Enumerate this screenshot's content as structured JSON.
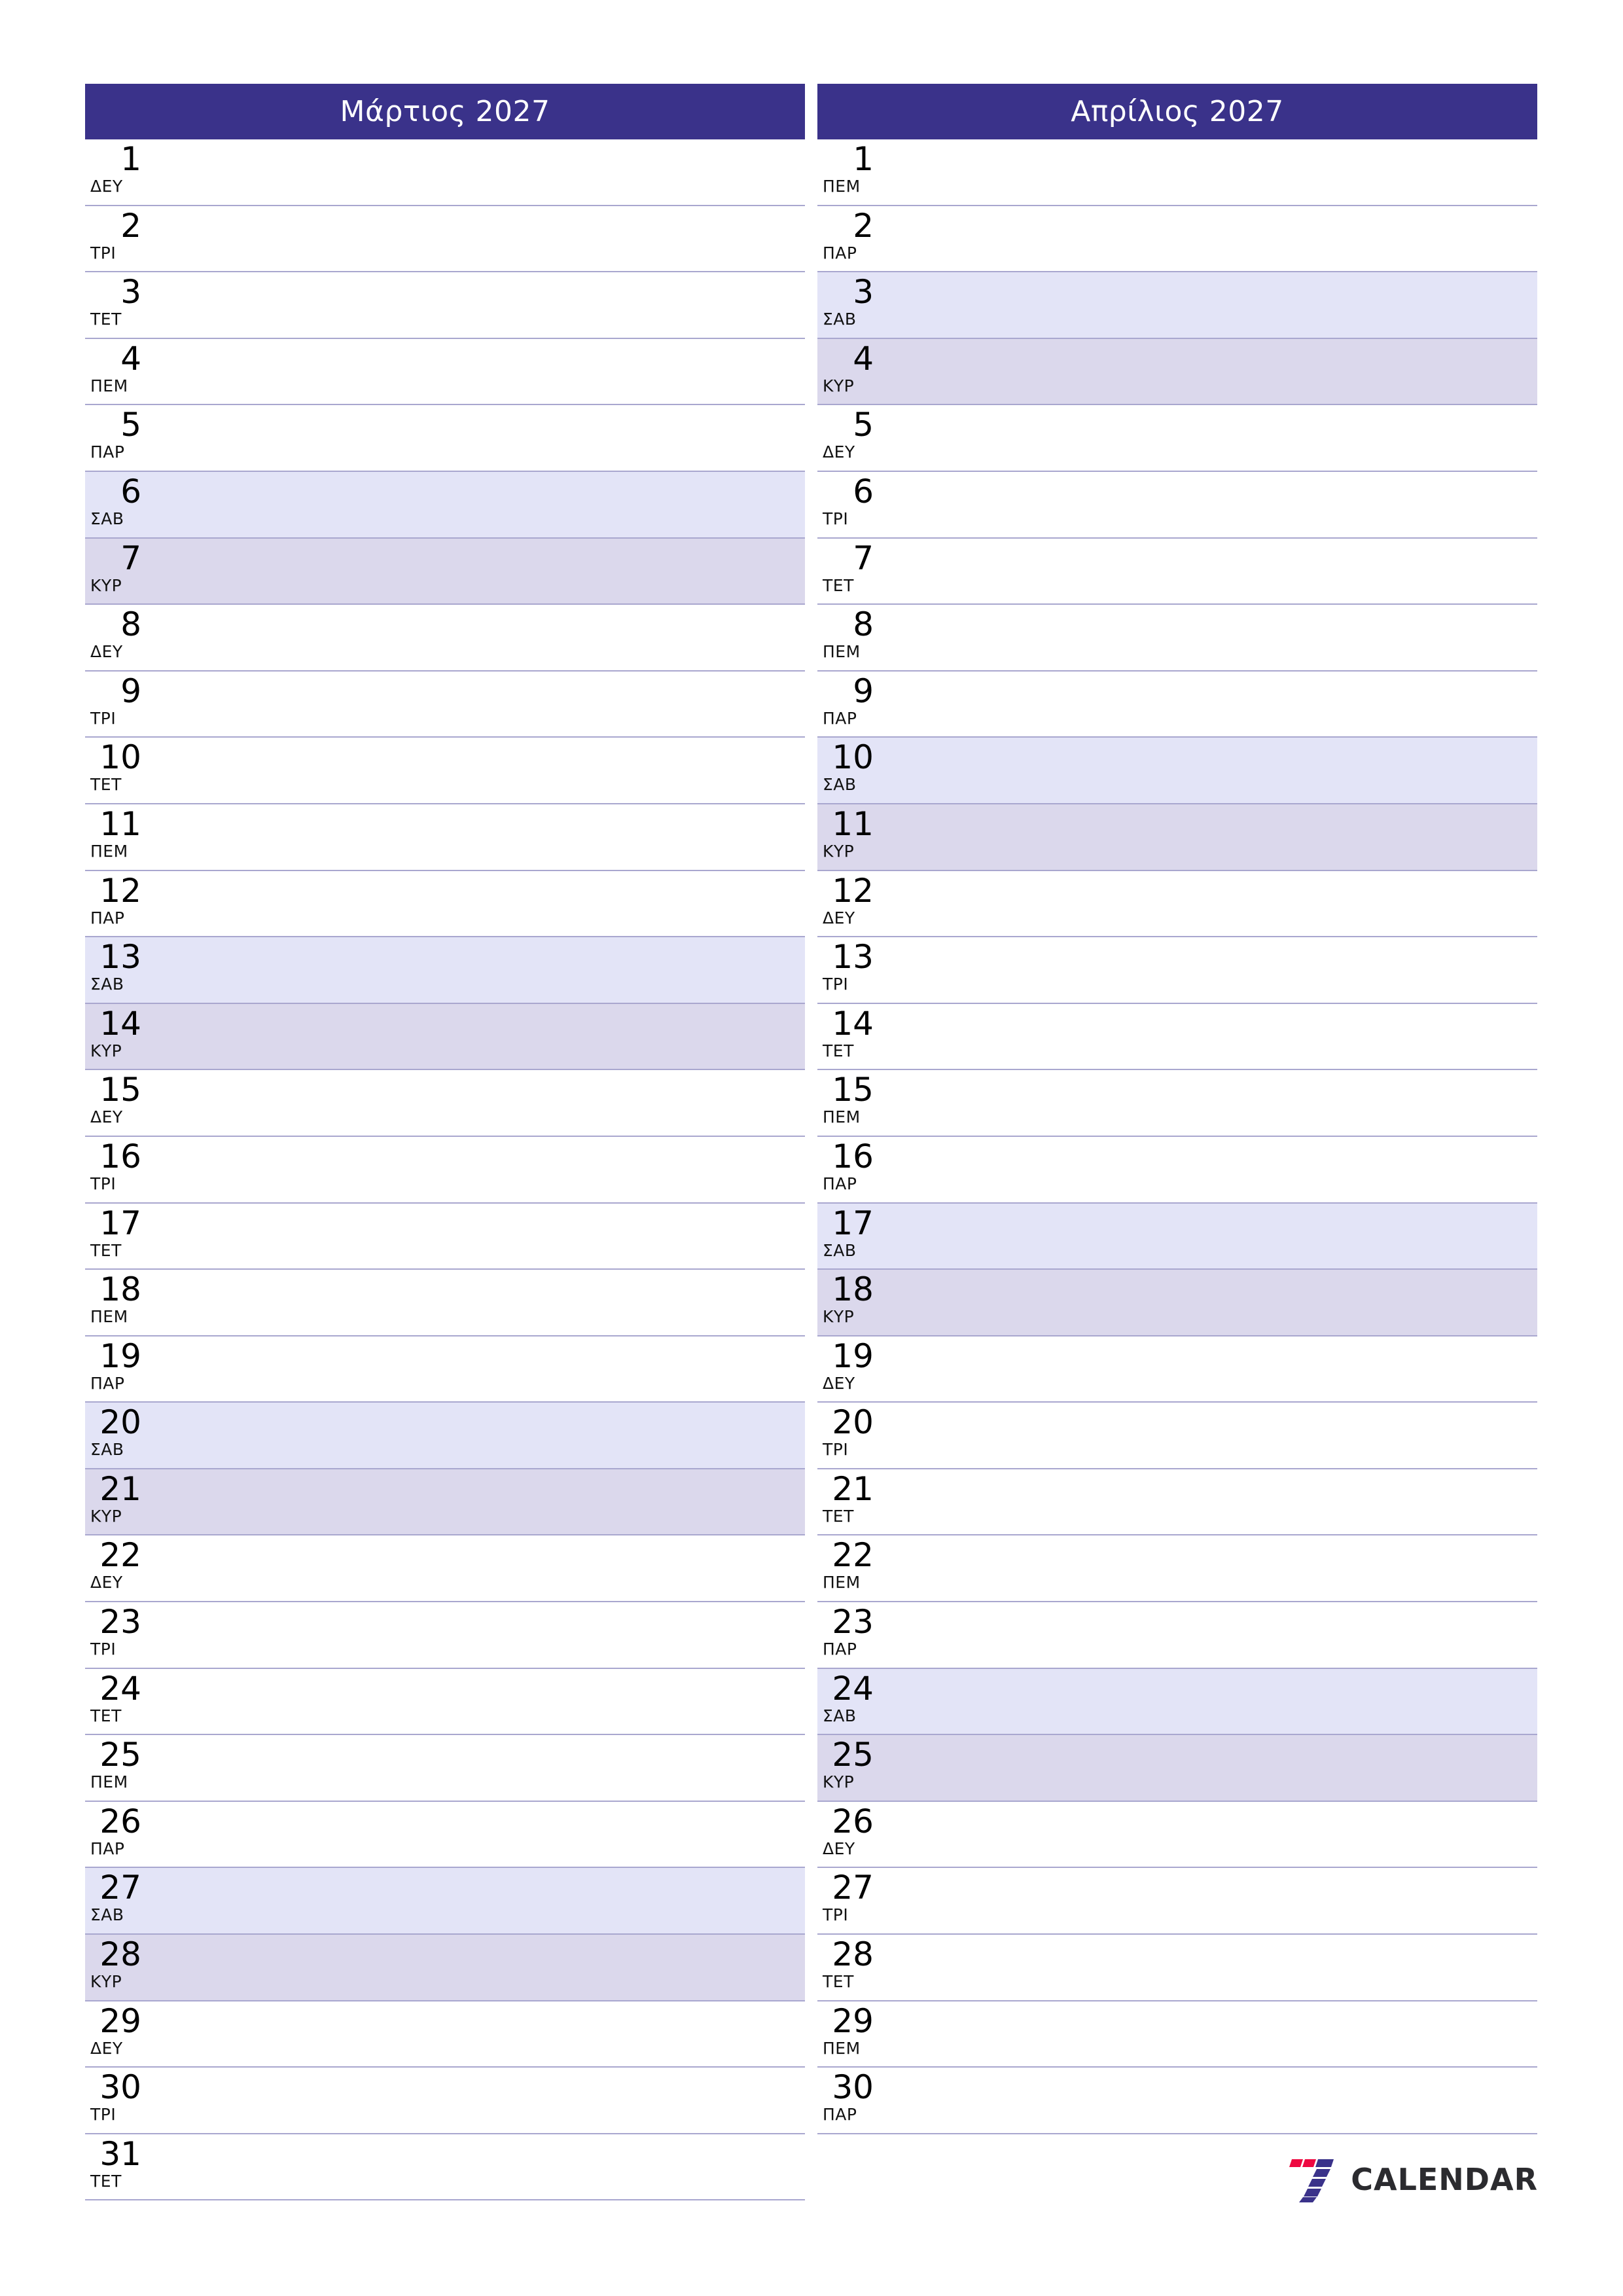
{
  "document": {
    "type": "monthly-planner",
    "year": "2027",
    "locale": "el"
  },
  "theme": {
    "header_bg": "#3a328a",
    "header_text": "#ffffff",
    "row_border": "#a9a7cf",
    "saturday_bg": "#e3e4f7",
    "sunday_bg": "#dbd8ec",
    "page_bg": "#ffffff",
    "logo_red": "#ee0840",
    "logo_blue": "#3a328a",
    "logo_text": "#2b2b2f"
  },
  "months": [
    {
      "title": "Μάρτιος 2027",
      "name": "Μάρτιος",
      "days": [
        {
          "num": "1",
          "dow": "ΔΕΥ",
          "kind": "weekday"
        },
        {
          "num": "2",
          "dow": "ΤΡΙ",
          "kind": "weekday"
        },
        {
          "num": "3",
          "dow": "ΤΕΤ",
          "kind": "weekday"
        },
        {
          "num": "4",
          "dow": "ΠΕΜ",
          "kind": "weekday"
        },
        {
          "num": "5",
          "dow": "ΠΑΡ",
          "kind": "weekday"
        },
        {
          "num": "6",
          "dow": "ΣΑΒ",
          "kind": "sat"
        },
        {
          "num": "7",
          "dow": "ΚΥΡ",
          "kind": "sun"
        },
        {
          "num": "8",
          "dow": "ΔΕΥ",
          "kind": "weekday"
        },
        {
          "num": "9",
          "dow": "ΤΡΙ",
          "kind": "weekday"
        },
        {
          "num": "10",
          "dow": "ΤΕΤ",
          "kind": "weekday"
        },
        {
          "num": "11",
          "dow": "ΠΕΜ",
          "kind": "weekday"
        },
        {
          "num": "12",
          "dow": "ΠΑΡ",
          "kind": "weekday"
        },
        {
          "num": "13",
          "dow": "ΣΑΒ",
          "kind": "sat"
        },
        {
          "num": "14",
          "dow": "ΚΥΡ",
          "kind": "sun"
        },
        {
          "num": "15",
          "dow": "ΔΕΥ",
          "kind": "weekday"
        },
        {
          "num": "16",
          "dow": "ΤΡΙ",
          "kind": "weekday"
        },
        {
          "num": "17",
          "dow": "ΤΕΤ",
          "kind": "weekday"
        },
        {
          "num": "18",
          "dow": "ΠΕΜ",
          "kind": "weekday"
        },
        {
          "num": "19",
          "dow": "ΠΑΡ",
          "kind": "weekday"
        },
        {
          "num": "20",
          "dow": "ΣΑΒ",
          "kind": "sat"
        },
        {
          "num": "21",
          "dow": "ΚΥΡ",
          "kind": "sun"
        },
        {
          "num": "22",
          "dow": "ΔΕΥ",
          "kind": "weekday"
        },
        {
          "num": "23",
          "dow": "ΤΡΙ",
          "kind": "weekday"
        },
        {
          "num": "24",
          "dow": "ΤΕΤ",
          "kind": "weekday"
        },
        {
          "num": "25",
          "dow": "ΠΕΜ",
          "kind": "weekday"
        },
        {
          "num": "26",
          "dow": "ΠΑΡ",
          "kind": "weekday"
        },
        {
          "num": "27",
          "dow": "ΣΑΒ",
          "kind": "sat"
        },
        {
          "num": "28",
          "dow": "ΚΥΡ",
          "kind": "sun"
        },
        {
          "num": "29",
          "dow": "ΔΕΥ",
          "kind": "weekday"
        },
        {
          "num": "30",
          "dow": "ΤΡΙ",
          "kind": "weekday"
        },
        {
          "num": "31",
          "dow": "ΤΕΤ",
          "kind": "weekday"
        }
      ]
    },
    {
      "title": "Απρίλιος 2027",
      "name": "Απρίλιος",
      "days": [
        {
          "num": "1",
          "dow": "ΠΕΜ",
          "kind": "weekday"
        },
        {
          "num": "2",
          "dow": "ΠΑΡ",
          "kind": "weekday"
        },
        {
          "num": "3",
          "dow": "ΣΑΒ",
          "kind": "sat"
        },
        {
          "num": "4",
          "dow": "ΚΥΡ",
          "kind": "sun"
        },
        {
          "num": "5",
          "dow": "ΔΕΥ",
          "kind": "weekday"
        },
        {
          "num": "6",
          "dow": "ΤΡΙ",
          "kind": "weekday"
        },
        {
          "num": "7",
          "dow": "ΤΕΤ",
          "kind": "weekday"
        },
        {
          "num": "8",
          "dow": "ΠΕΜ",
          "kind": "weekday"
        },
        {
          "num": "9",
          "dow": "ΠΑΡ",
          "kind": "weekday"
        },
        {
          "num": "10",
          "dow": "ΣΑΒ",
          "kind": "sat"
        },
        {
          "num": "11",
          "dow": "ΚΥΡ",
          "kind": "sun"
        },
        {
          "num": "12",
          "dow": "ΔΕΥ",
          "kind": "weekday"
        },
        {
          "num": "13",
          "dow": "ΤΡΙ",
          "kind": "weekday"
        },
        {
          "num": "14",
          "dow": "ΤΕΤ",
          "kind": "weekday"
        },
        {
          "num": "15",
          "dow": "ΠΕΜ",
          "kind": "weekday"
        },
        {
          "num": "16",
          "dow": "ΠΑΡ",
          "kind": "weekday"
        },
        {
          "num": "17",
          "dow": "ΣΑΒ",
          "kind": "sat"
        },
        {
          "num": "18",
          "dow": "ΚΥΡ",
          "kind": "sun"
        },
        {
          "num": "19",
          "dow": "ΔΕΥ",
          "kind": "weekday"
        },
        {
          "num": "20",
          "dow": "ΤΡΙ",
          "kind": "weekday"
        },
        {
          "num": "21",
          "dow": "ΤΕΤ",
          "kind": "weekday"
        },
        {
          "num": "22",
          "dow": "ΠΕΜ",
          "kind": "weekday"
        },
        {
          "num": "23",
          "dow": "ΠΑΡ",
          "kind": "weekday"
        },
        {
          "num": "24",
          "dow": "ΣΑΒ",
          "kind": "sat"
        },
        {
          "num": "25",
          "dow": "ΚΥΡ",
          "kind": "sun"
        },
        {
          "num": "26",
          "dow": "ΔΕΥ",
          "kind": "weekday"
        },
        {
          "num": "27",
          "dow": "ΤΡΙ",
          "kind": "weekday"
        },
        {
          "num": "28",
          "dow": "ΤΕΤ",
          "kind": "weekday"
        },
        {
          "num": "29",
          "dow": "ΠΕΜ",
          "kind": "weekday"
        },
        {
          "num": "30",
          "dow": "ΠΑΡ",
          "kind": "weekday"
        }
      ]
    }
  ],
  "footer": {
    "logo_text": "CALENDAR",
    "logo_mark": "seven-logo-icon"
  }
}
